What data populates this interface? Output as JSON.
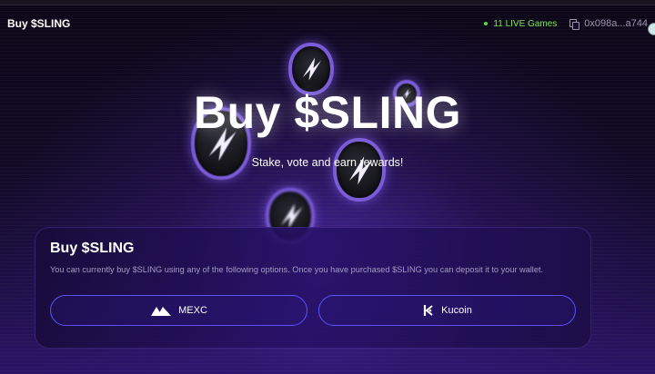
{
  "header": {
    "brand": "Buy $SLING",
    "live_games": "11 LIVE Games",
    "wallet_address": "0x098a...a744"
  },
  "hero": {
    "title": "Buy $SLING",
    "subtitle": "Stake, vote and earn rewards!"
  },
  "buy_card": {
    "title": "Buy $SLING",
    "description": "You can currently buy $SLING using any of the following options. Once you have purchased $SLING you can deposit it to your wallet.",
    "options": [
      {
        "label": "MEXC",
        "icon": "mexc-logo-icon"
      },
      {
        "label": "Kucoin",
        "icon": "kucoin-logo-icon"
      }
    ]
  },
  "colors": {
    "accent": "#5b54ff",
    "live": "#7ee35a",
    "background": "#0c0717"
  }
}
